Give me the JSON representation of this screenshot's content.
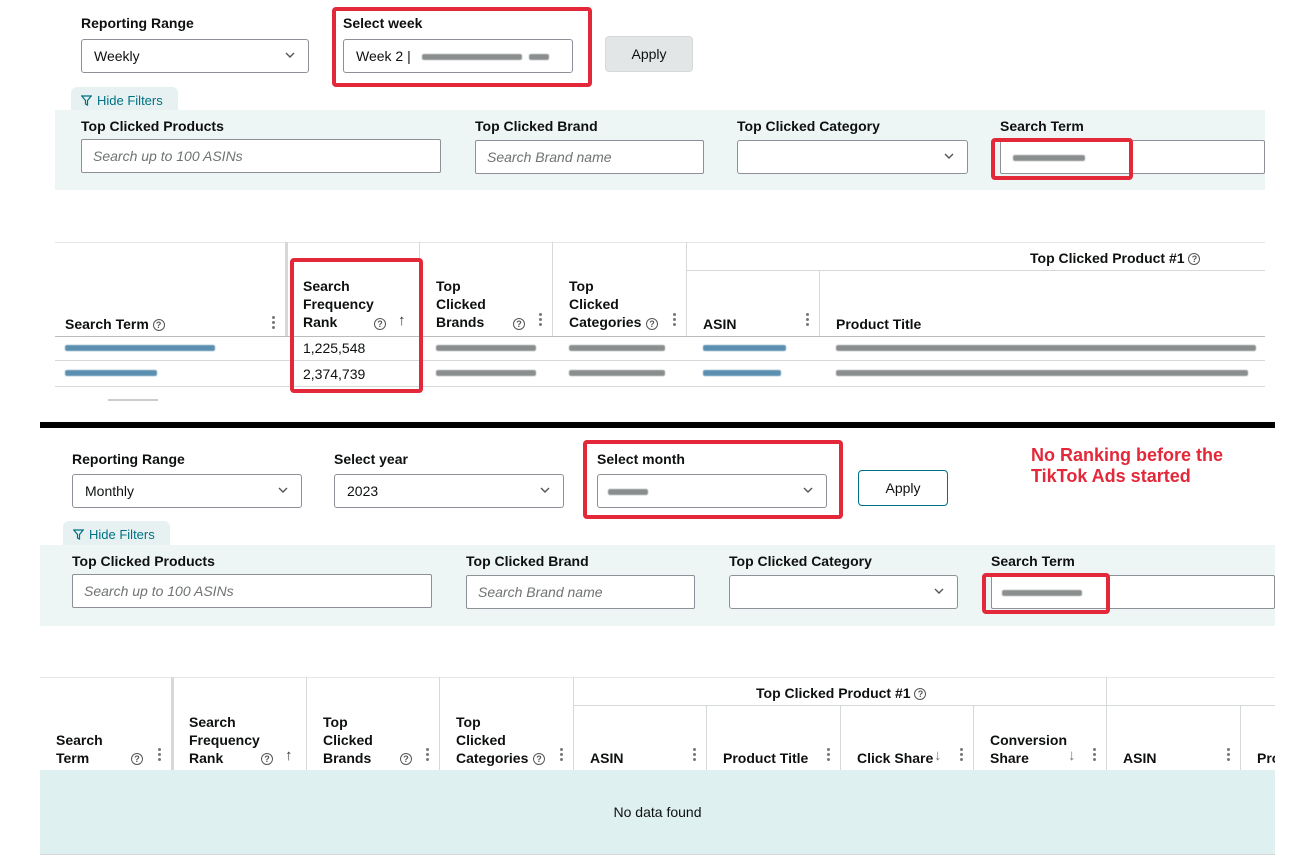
{
  "top": {
    "reporting_range_label": "Reporting Range",
    "reporting_range_value": "Weekly",
    "select_week_label": "Select week",
    "select_week_value": "Week 2 |",
    "apply_label": "Apply",
    "hide_filters_label": "Hide Filters",
    "filters": {
      "products_label": "Top Clicked Products",
      "products_placeholder": "Search up to 100 ASINs",
      "brand_label": "Top Clicked Brand",
      "brand_placeholder": "Search Brand name",
      "category_label": "Top Clicked Category",
      "search_term_label": "Search Term"
    },
    "table": {
      "group_header": "Top Clicked Product #1",
      "columns": [
        "Search Term",
        "Search Frequency Rank",
        "Top Clicked Brands",
        "Top Clicked Categories",
        "ASIN",
        "Product Title"
      ],
      "rows": [
        {
          "rank": "1,225,548"
        },
        {
          "rank": "2,374,739"
        }
      ]
    }
  },
  "bottom": {
    "reporting_range_label": "Reporting Range",
    "reporting_range_value": "Monthly",
    "select_year_label": "Select year",
    "select_year_value": "2023",
    "select_month_label": "Select month",
    "apply_label": "Apply",
    "annotation": "No Ranking before the TikTok Ads started",
    "hide_filters_label": "Hide Filters",
    "filters": {
      "products_label": "Top Clicked Products",
      "products_placeholder": "Search up to 100 ASINs",
      "brand_label": "Top Clicked Brand",
      "brand_placeholder": "Search Brand name",
      "category_label": "Top Clicked Category",
      "search_term_label": "Search Term"
    },
    "table": {
      "group_header": "Top Clicked Product #1",
      "columns": [
        "Search Term",
        "Search Frequency Rank",
        "Top Clicked Brands",
        "Top Clicked Categories",
        "ASIN",
        "Product Title",
        "Click Share",
        "Conversion Share",
        "ASIN",
        "Pro"
      ],
      "empty_message": "No data found"
    }
  },
  "colors": {
    "highlight": "#e3283a",
    "filter_panel": "#eef5f5",
    "link": "#007185",
    "empty_bg": "#dff0f0"
  }
}
